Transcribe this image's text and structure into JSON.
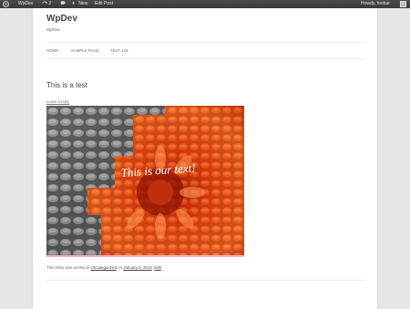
{
  "adminbar": {
    "site_name": "WpDev",
    "comments_count": "2",
    "new_label": "New",
    "edit_label": "Edit Post",
    "greeting": "Howdy, foobar",
    "icon_names": [
      "wordpress-logo-icon",
      "comments-icon",
      "speech-bubble-icon",
      "plus-icon",
      "avatar-icon"
    ]
  },
  "site": {
    "title": "WpDev",
    "description": "WpDev"
  },
  "nav": {
    "items": [
      "HOME",
      "SAMPLE PAGE",
      "TEST 123"
    ]
  },
  "post": {
    "title": "This is a test",
    "leave_reply": "Leave a reply",
    "image_caption": "This is our text!",
    "meta_prefix": "This entry was posted in",
    "category": "Uncategorized",
    "meta_on": "on",
    "date": "January 6, 2013",
    "edit": "Edit"
  },
  "colors": {
    "adminbar": "#3d3d3d",
    "page_bg": "#e6e6e6",
    "image_border": "#f4aad8",
    "flower_orange": "#e8501a"
  }
}
